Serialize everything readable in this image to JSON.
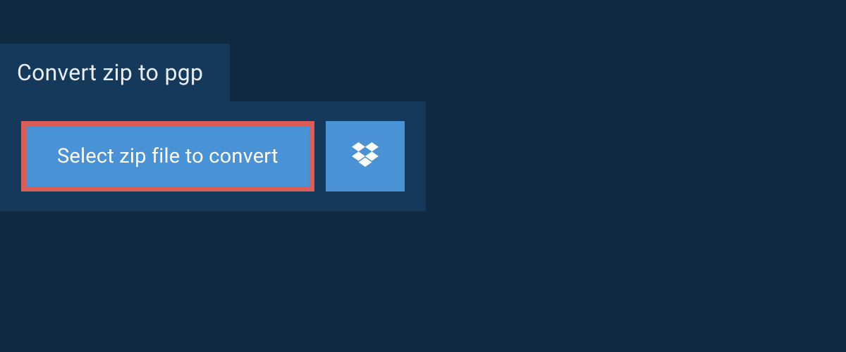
{
  "header": {
    "title": "Convert zip to pgp"
  },
  "upload": {
    "select_button_label": "Select zip file to convert",
    "dropbox_icon": "dropbox"
  },
  "colors": {
    "page_bg": "#0f2940",
    "panel_bg": "#14395a",
    "button_bg": "#4a92d6",
    "highlight_border": "#d95c55",
    "text_light": "#e8eef4",
    "text_white": "#ffffff"
  }
}
